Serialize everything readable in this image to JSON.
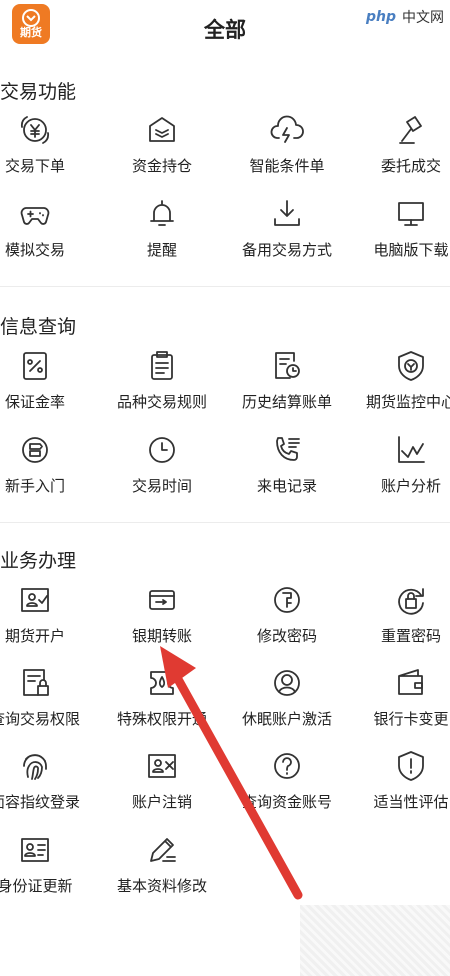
{
  "header": {
    "title": "全部",
    "logo_text": "期货",
    "watermark_brand": "php",
    "watermark_site": "中文网"
  },
  "colors": {
    "accent": "#ef7a23",
    "icon": "#333333",
    "arrow": "#e03a32"
  },
  "sections": [
    {
      "title": "交易功能",
      "items": [
        {
          "label": "交易下单",
          "icon": "yen-circle-icon"
        },
        {
          "label": "资金持仓",
          "icon": "house-stack-icon"
        },
        {
          "label": "智能条件单",
          "icon": "cloud-lightning-icon"
        },
        {
          "label": "委托成交",
          "icon": "gavel-icon"
        },
        {
          "label": "模拟交易",
          "icon": "gamepad-icon"
        },
        {
          "label": "提醒",
          "icon": "bell-icon"
        },
        {
          "label": "备用交易方式",
          "icon": "download-tray-icon"
        },
        {
          "label": "电脑版下载",
          "icon": "monitor-icon"
        }
      ]
    },
    {
      "title": "信息查询",
      "items": [
        {
          "label": "保证金率",
          "icon": "percent-doc-icon"
        },
        {
          "label": "品种交易规则",
          "icon": "clipboard-icon"
        },
        {
          "label": "历史结算账单",
          "icon": "doc-clock-icon"
        },
        {
          "label": "期货监控中心",
          "icon": "shield-coin-icon"
        },
        {
          "label": "新手入门",
          "icon": "signpost-icon"
        },
        {
          "label": "交易时间",
          "icon": "clock-icon"
        },
        {
          "label": "来电记录",
          "icon": "phone-list-icon"
        },
        {
          "label": "账户分析",
          "icon": "line-chart-icon"
        }
      ]
    },
    {
      "title": "业务办理",
      "items": [
        {
          "label": "期货开户",
          "icon": "id-check-icon"
        },
        {
          "label": "银期转账",
          "icon": "card-transfer-icon"
        },
        {
          "label": "修改密码",
          "icon": "key-circle-icon"
        },
        {
          "label": "重置密码",
          "icon": "lock-refresh-icon"
        },
        {
          "label": "查询交易权限",
          "icon": "doc-lock-icon"
        },
        {
          "label": "特殊权限开通",
          "icon": "ticket-drop-icon"
        },
        {
          "label": "休眠账户激活",
          "icon": "user-circle-icon"
        },
        {
          "label": "银行卡变更",
          "icon": "wallet-icon"
        },
        {
          "label": "面容指纹登录",
          "icon": "fingerprint-icon"
        },
        {
          "label": "账户注销",
          "icon": "id-cross-icon"
        },
        {
          "label": "查询资金账号",
          "icon": "question-circle-icon"
        },
        {
          "label": "适当性评估",
          "icon": "shield-alert-icon"
        },
        {
          "label": "身份证更新",
          "icon": "id-card-icon"
        },
        {
          "label": "基本资料修改",
          "icon": "pen-lines-icon"
        }
      ]
    }
  ]
}
